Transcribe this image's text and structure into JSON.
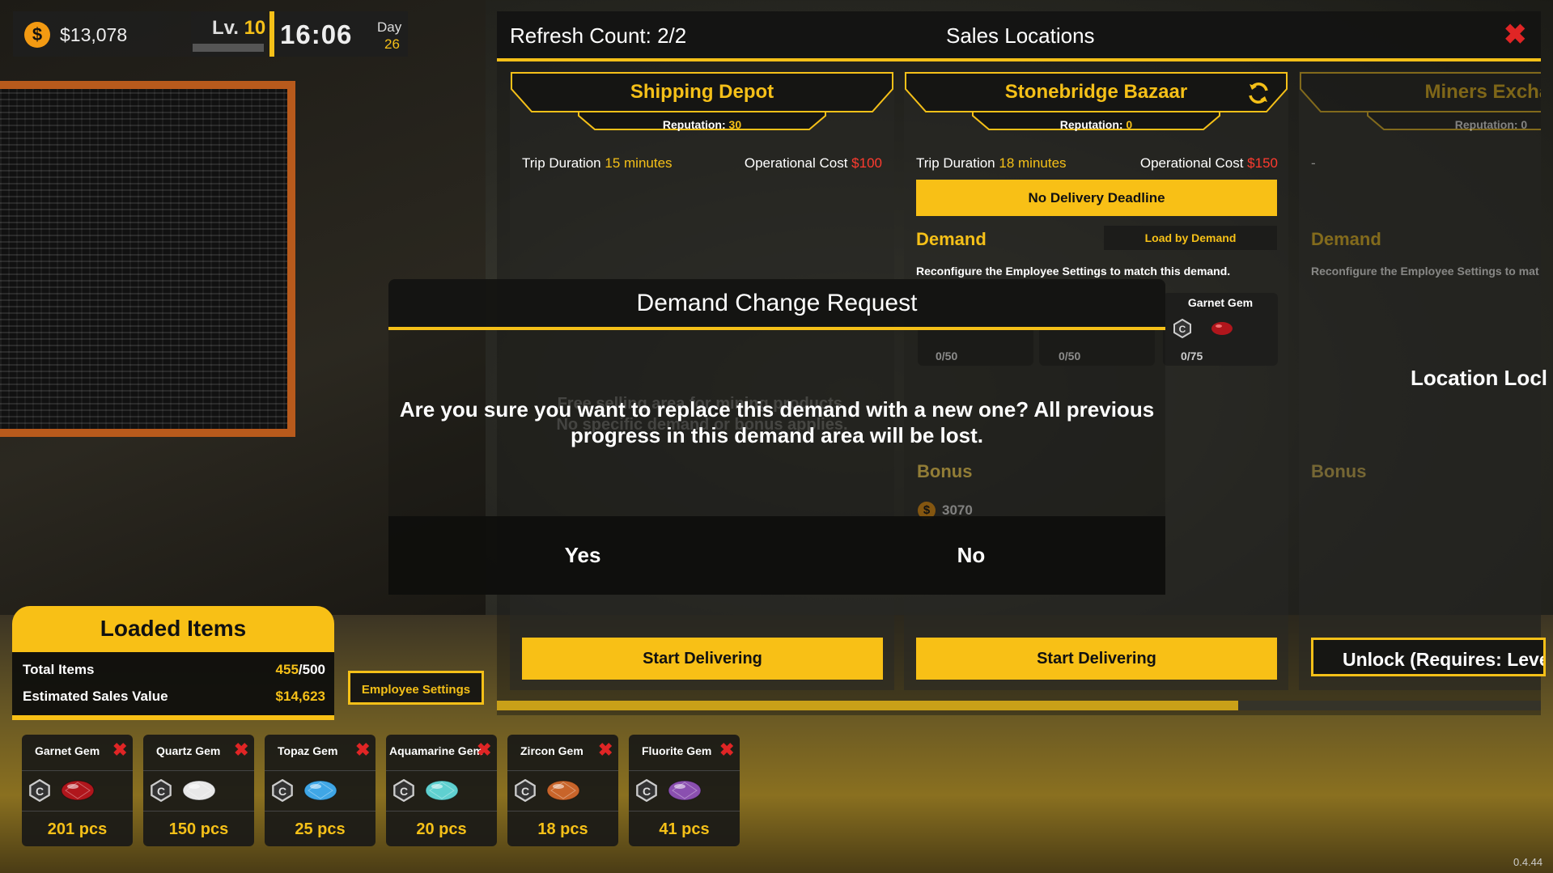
{
  "hud": {
    "money": "$13,078",
    "coin_symbol": "$",
    "level_label": "Lv.",
    "level_value": "10",
    "time": "16:06",
    "day_label": "Day",
    "day_value": "26"
  },
  "sales": {
    "refresh_label": "Refresh Count: 2/2",
    "title": "Sales Locations",
    "delivery_progress": 0.71,
    "locations": [
      {
        "name": "Shipping Depot",
        "reputation_label": "Reputation:",
        "reputation_value": "30",
        "trip_label": "Trip Duration",
        "trip_value": "15 minutes",
        "cost_label": "Operational Cost",
        "cost_value": "$100",
        "ghost_text_1": "Free selling area for mining products.",
        "ghost_text_2": "No specific demand or bonus applies.",
        "button": "Start Delivering"
      },
      {
        "name": "Stonebridge Bazaar",
        "reputation_label": "Reputation:",
        "reputation_value": "0",
        "trip_label": "Trip Duration",
        "trip_value": "18 minutes",
        "cost_label": "Operational Cost",
        "cost_value": "$150",
        "deadline": "No Delivery Deadline",
        "demand_label": "Demand",
        "load_by_demand": "Load by Demand",
        "reconfigure": "Reconfigure the Employee Settings to match this demand.",
        "slots": [
          {
            "count": "0/50"
          },
          {
            "count": "0/50"
          },
          {
            "name": "Garnet Gem",
            "count": "0/75"
          }
        ],
        "bonus_label": "Bonus",
        "bonus_value": "3070",
        "button": "Start Delivering"
      },
      {
        "name": "Miners Exchar",
        "reputation_label": "Reputation:",
        "reputation_value": "0",
        "trip_value": "-",
        "demand_label": "Demand",
        "reconfigure": "Reconfigure the Employee Settings to mat",
        "locked": "Location Locl",
        "bonus_label": "Bonus",
        "button": "Unlock (Requires: Leve"
      }
    ]
  },
  "dialog": {
    "title": "Demand Change Request",
    "message_line1": "Are you sure you want to replace this demand with a new one? All previous",
    "message_line2": "progress in this demand area will be lost.",
    "yes": "Yes",
    "no": "No"
  },
  "loaded": {
    "title": "Loaded Items",
    "total_label": "Total Items",
    "total_current": "455",
    "total_max": "/500",
    "value_label": "Estimated Sales Value",
    "value": "$14,623",
    "employee_settings": "Employee Settings",
    "gems": [
      {
        "name": "Garnet Gem",
        "qty": "201 pcs",
        "color": "#b0161c"
      },
      {
        "name": "Quartz Gem",
        "qty": "150 pcs",
        "color": "#e8e8e8"
      },
      {
        "name": "Topaz Gem",
        "qty": "25 pcs",
        "color": "#3fa6e6"
      },
      {
        "name": "Aquamarine Gem",
        "qty": "20 pcs",
        "color": "#5fd0d0"
      },
      {
        "name": "Zircon Gem",
        "qty": "18 pcs",
        "color": "#c8642a"
      },
      {
        "name": "Fluorite Gem",
        "qty": "41 pcs",
        "color": "#8a4fb0"
      }
    ],
    "gem_badge": "C"
  },
  "version": "0.4.44"
}
